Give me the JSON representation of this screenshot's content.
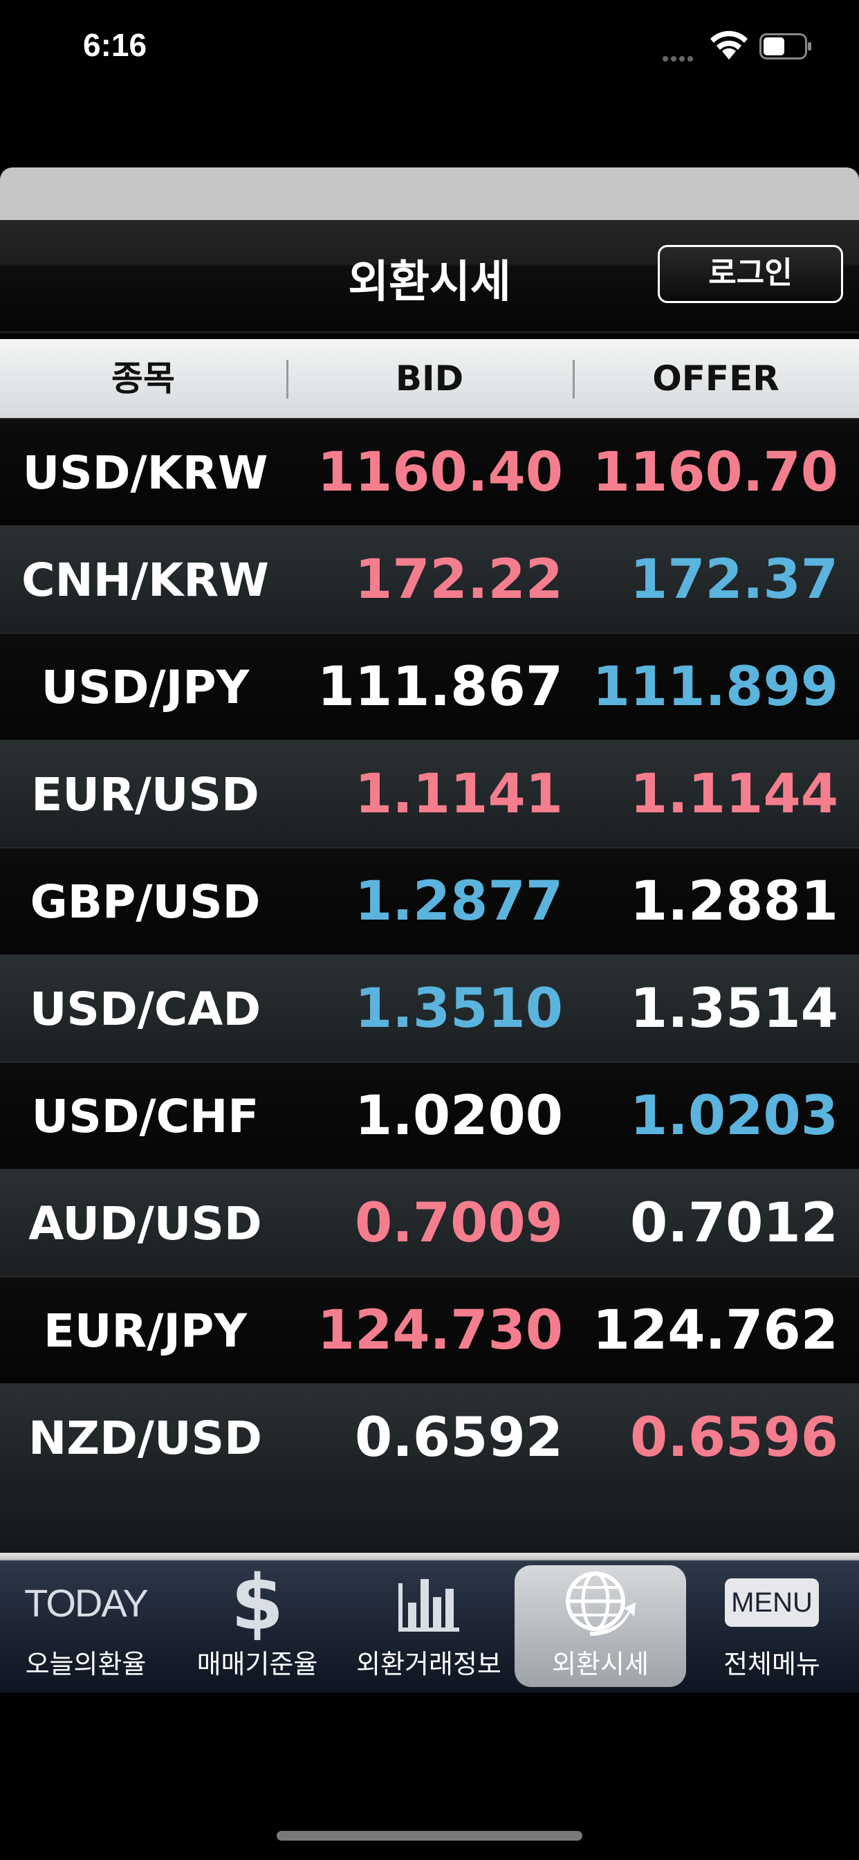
{
  "status": {
    "time": "6:16"
  },
  "nav": {
    "title": "외환시세",
    "login_label": "로그인"
  },
  "table": {
    "headers": [
      "종목",
      "BID",
      "OFFER"
    ],
    "rows": [
      {
        "pair": "USD/KRW",
        "bid": "1160.40",
        "offer": "1160.70",
        "bid_color": "red",
        "offer_color": "red"
      },
      {
        "pair": "CNH/KRW",
        "bid": "172.22",
        "offer": "172.37",
        "bid_color": "red",
        "offer_color": "blue"
      },
      {
        "pair": "USD/JPY",
        "bid": "111.867",
        "offer": "111.899",
        "bid_color": "white",
        "offer_color": "blue"
      },
      {
        "pair": "EUR/USD",
        "bid": "1.1141",
        "offer": "1.1144",
        "bid_color": "red",
        "offer_color": "red"
      },
      {
        "pair": "GBP/USD",
        "bid": "1.2877",
        "offer": "1.2881",
        "bid_color": "blue",
        "offer_color": "white"
      },
      {
        "pair": "USD/CAD",
        "bid": "1.3510",
        "offer": "1.3514",
        "bid_color": "blue",
        "offer_color": "white"
      },
      {
        "pair": "USD/CHF",
        "bid": "1.0200",
        "offer": "1.0203",
        "bid_color": "white",
        "offer_color": "blue"
      },
      {
        "pair": "AUD/USD",
        "bid": "0.7009",
        "offer": "0.7012",
        "bid_color": "red",
        "offer_color": "white"
      },
      {
        "pair": "EUR/JPY",
        "bid": "124.730",
        "offer": "124.762",
        "bid_color": "red",
        "offer_color": "white"
      },
      {
        "pair": "NZD/USD",
        "bid": "0.6592",
        "offer": "0.6596",
        "bid_color": "white",
        "offer_color": "red"
      }
    ]
  },
  "colors": {
    "red": "#f57e8e",
    "blue": "#5bb4dd",
    "white": "#ffffff"
  },
  "tabbar": {
    "items": [
      {
        "label": "오늘의환율",
        "icon": "today-icon",
        "icon_text": "TODAY"
      },
      {
        "label": "매매기준율",
        "icon": "dollar-icon",
        "icon_text": "$"
      },
      {
        "label": "외환거래정보",
        "icon": "bar-chart-icon"
      },
      {
        "label": "외환시세",
        "icon": "globe-arrow-icon",
        "active": true
      },
      {
        "label": "전체메뉴",
        "icon": "menu-icon",
        "icon_text": "MENU"
      }
    ]
  }
}
